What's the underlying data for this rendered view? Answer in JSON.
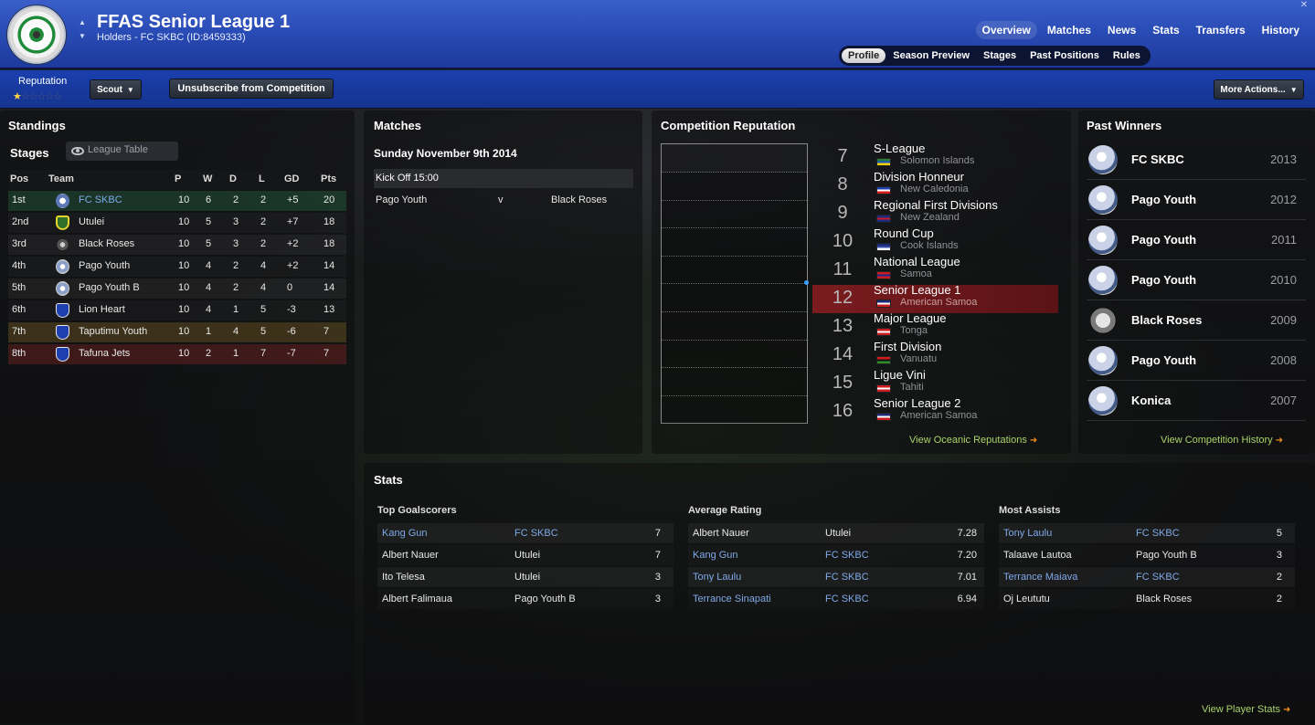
{
  "header": {
    "title": "FFAS Senior League 1",
    "subtitle": "Holders - FC SKBC (ID:8459333)",
    "nav": [
      "Overview",
      "Matches",
      "News",
      "Stats",
      "Transfers",
      "History"
    ],
    "subnav": [
      "Profile",
      "Season Preview",
      "Stages",
      "Past Positions",
      "Rules"
    ],
    "close": "✕"
  },
  "toolbar": {
    "reputation_label": "Reputation",
    "reputation_stars": 0.5,
    "scout": "Scout",
    "unsubscribe": "Unsubscribe from Competition",
    "more_actions": "More Actions..."
  },
  "standings": {
    "title": "Standings",
    "stages_label": "Stages",
    "view_select": "League Table",
    "headers": [
      "Pos",
      "Team",
      "P",
      "W",
      "D",
      "L",
      "GD",
      "Pts"
    ],
    "rows": [
      {
        "pos": "1st",
        "team": "FC SKBC",
        "p": "10",
        "w": "6",
        "d": "2",
        "l": "2",
        "gd": "+5",
        "pts": "20",
        "link": true
      },
      {
        "pos": "2nd",
        "team": "Utulei",
        "p": "10",
        "w": "5",
        "d": "3",
        "l": "2",
        "gd": "+7",
        "pts": "18"
      },
      {
        "pos": "3rd",
        "team": "Black Roses",
        "p": "10",
        "w": "5",
        "d": "3",
        "l": "2",
        "gd": "+2",
        "pts": "18"
      },
      {
        "pos": "4th",
        "team": "Pago Youth",
        "p": "10",
        "w": "4",
        "d": "2",
        "l": "4",
        "gd": "+2",
        "pts": "14"
      },
      {
        "pos": "5th",
        "team": "Pago Youth B",
        "p": "10",
        "w": "4",
        "d": "2",
        "l": "4",
        "gd": "0",
        "pts": "14"
      },
      {
        "pos": "6th",
        "team": "Lion Heart",
        "p": "10",
        "w": "4",
        "d": "1",
        "l": "5",
        "gd": "-3",
        "pts": "13"
      },
      {
        "pos": "7th",
        "team": "Taputimu Youth",
        "p": "10",
        "w": "1",
        "d": "4",
        "l": "5",
        "gd": "-6",
        "pts": "7"
      },
      {
        "pos": "8th",
        "team": "Tafuna Jets",
        "p": "10",
        "w": "2",
        "d": "1",
        "l": "7",
        "gd": "-7",
        "pts": "7"
      }
    ]
  },
  "matches": {
    "title": "Matches",
    "date": "Sunday November 9th 2014",
    "kickoff": "Kick Off 15:00",
    "home": "Pago Youth",
    "vs": "v",
    "away": "Black Roses"
  },
  "competition_reputation": {
    "title": "Competition Reputation",
    "rows": [
      {
        "rank": "7",
        "name": "S-League",
        "country": "Solomon Islands",
        "flag": [
          "#2b7d3a",
          "#1c52c4",
          "#f5d10a"
        ]
      },
      {
        "rank": "8",
        "name": "Division Honneur",
        "country": "New Caledonia",
        "flag": [
          "#1f3fb0",
          "#ffffff",
          "#d91c1c"
        ]
      },
      {
        "rank": "9",
        "name": "Regional First Divisions",
        "country": "New Zealand",
        "flag": [
          "#1b2a7a",
          "#c81c2a",
          "#1b2a7a"
        ]
      },
      {
        "rank": "10",
        "name": "Round Cup",
        "country": "Cook Islands",
        "flag": [
          "#1b2a7a",
          "#3a4fa8",
          "#ffffff"
        ]
      },
      {
        "rank": "11",
        "name": "National League",
        "country": "Samoa",
        "flag": [
          "#c91c22",
          "#1b2a8a",
          "#c91c22"
        ]
      },
      {
        "rank": "12",
        "name": "Senior League 1",
        "country": "American Samoa",
        "flag": [
          "#1b2a7a",
          "#ffffff",
          "#c91c22"
        ],
        "highlight": true
      },
      {
        "rank": "13",
        "name": "Major League",
        "country": "Tonga",
        "flag": [
          "#c91c22",
          "#ffffff",
          "#c91c22"
        ]
      },
      {
        "rank": "14",
        "name": "First Division",
        "country": "Vanuatu",
        "flag": [
          "#d21c1c",
          "#111111",
          "#2f8a2a"
        ]
      },
      {
        "rank": "15",
        "name": "Ligue Vini",
        "country": "Tahiti",
        "flag": [
          "#cf1c22",
          "#ffffff",
          "#cf1c22"
        ]
      },
      {
        "rank": "16",
        "name": "Senior League 2",
        "country": "American Samoa",
        "flag": [
          "#1b2a7a",
          "#ffffff",
          "#c91c22"
        ]
      }
    ],
    "view_link": "View Oceanic Reputations"
  },
  "past_winners": {
    "title": "Past Winners",
    "rows": [
      {
        "team": "FC SKBC",
        "year": "2013",
        "crest": "skbc-crest-icon"
      },
      {
        "team": "Pago Youth",
        "year": "2012",
        "crest": "pago-youth-crest-icon"
      },
      {
        "team": "Pago Youth",
        "year": "2011",
        "crest": "pago-youth-crest-icon"
      },
      {
        "team": "Pago Youth",
        "year": "2010",
        "crest": "pago-youth-crest-icon"
      },
      {
        "team": "Black Roses",
        "year": "2009",
        "crest": "black-roses-crest-icon"
      },
      {
        "team": "Pago Youth",
        "year": "2008",
        "crest": "pago-youth-crest-icon"
      },
      {
        "team": "Konica",
        "year": "2007",
        "crest": "konica-crest-icon"
      }
    ],
    "view_link": "View Competition History"
  },
  "stats": {
    "title": "Stats",
    "goalscorers": {
      "title": "Top Goalscorers",
      "rows": [
        {
          "player": "Kang Gun",
          "team": "FC SKBC",
          "value": "7",
          "link": true
        },
        {
          "player": "Albert Nauer",
          "team": "Utulei",
          "value": "7"
        },
        {
          "player": "Ito Telesa",
          "team": "Utulei",
          "value": "3"
        },
        {
          "player": "Albert Falimaua",
          "team": "Pago Youth B",
          "value": "3"
        }
      ]
    },
    "rating": {
      "title": "Average Rating",
      "rows": [
        {
          "player": "Albert Nauer",
          "team": "Utulei",
          "value": "7.28"
        },
        {
          "player": "Kang Gun",
          "team": "FC SKBC",
          "value": "7.20",
          "link": true
        },
        {
          "player": "Tony Laulu",
          "team": "FC SKBC",
          "value": "7.01",
          "link": true
        },
        {
          "player": "Terrance Sinapati",
          "team": "FC SKBC",
          "value": "6.94",
          "link": true
        }
      ]
    },
    "assists": {
      "title": "Most Assists",
      "rows": [
        {
          "player": "Tony Laulu",
          "team": "FC SKBC",
          "value": "5",
          "link": true
        },
        {
          "player": "Talaave Lautoa",
          "team": "Pago Youth B",
          "value": "3"
        },
        {
          "player": "Terrance Maiava",
          "team": "FC SKBC",
          "value": "2",
          "link": true
        },
        {
          "player": "Oj Leututu",
          "team": "Black Roses",
          "value": "2"
        }
      ]
    },
    "view_link": "View Player Stats"
  }
}
